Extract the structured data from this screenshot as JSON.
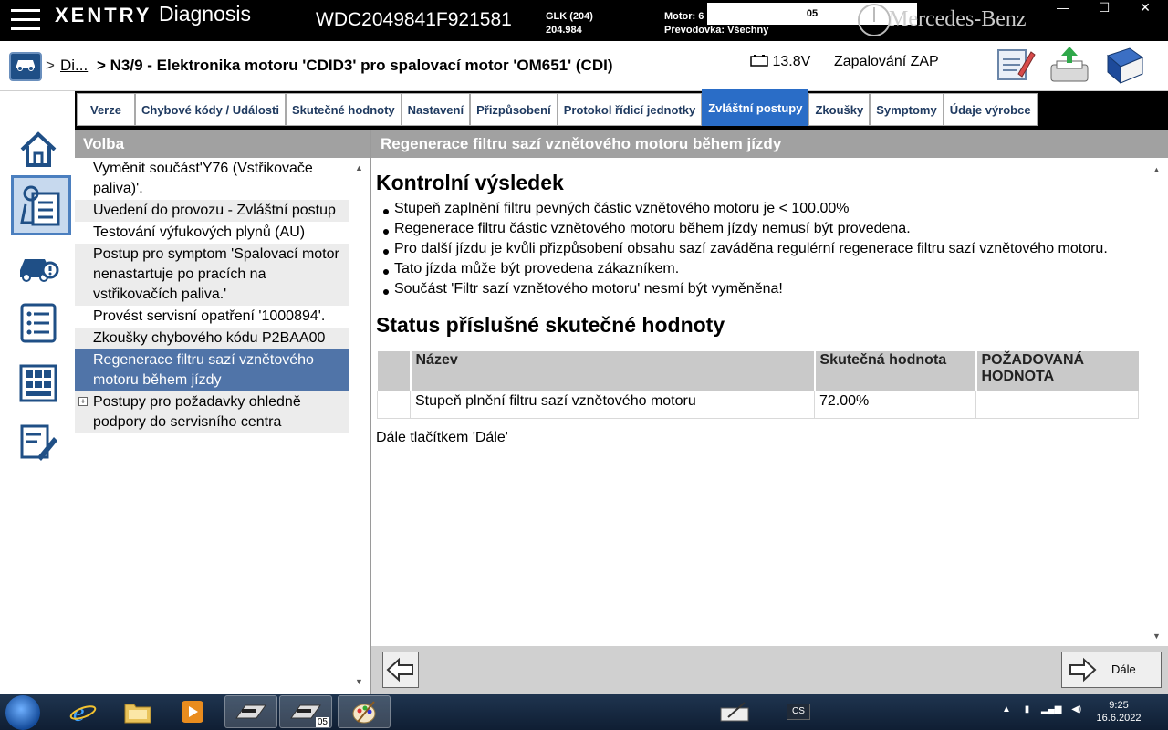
{
  "titlebar": {
    "brand": "XENTRY",
    "app": "Diagnosis",
    "vin": "WDC2049841F921581",
    "model_line1": "GLK (204)",
    "model_line2": "204.984",
    "motor_label": "Motor: 6",
    "transmission": "Převodovka: Všechny",
    "overlay_text": "05",
    "maker": "Mercedes-Benz",
    "minimize": "—",
    "restore": "☐",
    "close": "✕"
  },
  "header": {
    "breadcrumb_sep": ">",
    "breadcrumb_link": "Di...",
    "title": "> N3/9 - Elektronika motoru 'CDID3' pro spalovací motor 'OM651' (CDI)",
    "voltage": "13.8V",
    "ignition": "Zapalování ZAP"
  },
  "tabs": [
    {
      "label": "Verze"
    },
    {
      "label": "Chybové kódy / Události"
    },
    {
      "label": "Skutečné hodnoty"
    },
    {
      "label": "Nastavení"
    },
    {
      "label": "Přizpůsobení"
    },
    {
      "label": "Protokol řídicí jednotky"
    },
    {
      "label": "Zvláštní postupy",
      "active": true
    },
    {
      "label": "Zkoušky"
    },
    {
      "label": "Symptomy"
    },
    {
      "label": "Údaje výrobce"
    }
  ],
  "left_panel": {
    "title": "Volba",
    "items": [
      {
        "label": "Vyměnit součást'Y76 (Vstřikovače paliva)'."
      },
      {
        "label": "Uvedení do provozu - Zvláštní postup"
      },
      {
        "label": "Testování výfukových plynů (AU)"
      },
      {
        "label": "Postup pro symptom 'Spalovací motor nenastartuje po pracích na vstřikovačích paliva.'"
      },
      {
        "label": "Provést servisní opatření '1000894'."
      },
      {
        "label": "Zkoušky chybového kódu P2BAA00"
      },
      {
        "label": "Regenerace filtru sazí vznětového motoru během jízdy",
        "selected": true
      },
      {
        "label": "Postupy pro požadavky ohledně podpory do servisního centra",
        "expandable": true
      }
    ]
  },
  "right_panel": {
    "title": "Regenerace filtru sazí vznětového motoru během jízdy",
    "heading1": "Kontrolní výsledek",
    "bullets": [
      "Stupeň zaplnění filtru pevných částic vznětového motoru je < 100.00%",
      "Regenerace filtru částic vznětového motoru během jízdy nemusí být provedena.",
      "Pro další jízdu je kvůli přizpůsobení obsahu sazí zaváděna regulérní regenerace filtru sazí vznětového motoru.",
      "Tato jízda může být provedena zákazníkem.",
      "Součást 'Filtr sazí vznětového motoru' nesmí být vyměněna!"
    ],
    "heading2": "Status příslušné skutečné hodnoty",
    "table": {
      "headers": [
        "",
        "Název",
        "Skutečná hodnota",
        "POŽADOVANÁ HODNOTA"
      ],
      "rows": [
        [
          "",
          "Stupeň plnění filtru sazí vznětového motoru",
          "72.00%",
          ""
        ]
      ]
    },
    "note": "Dále tlačítkem 'Dále'"
  },
  "bottom": {
    "next_label": "Dále"
  },
  "taskbar": {
    "badge": "05",
    "lang": "CS",
    "time": "9:25",
    "date": "16.6.2022"
  },
  "colors": {
    "accent": "#2a6dc7",
    "selected_item": "#5074a8",
    "panel_header": "#a1a1a1"
  }
}
